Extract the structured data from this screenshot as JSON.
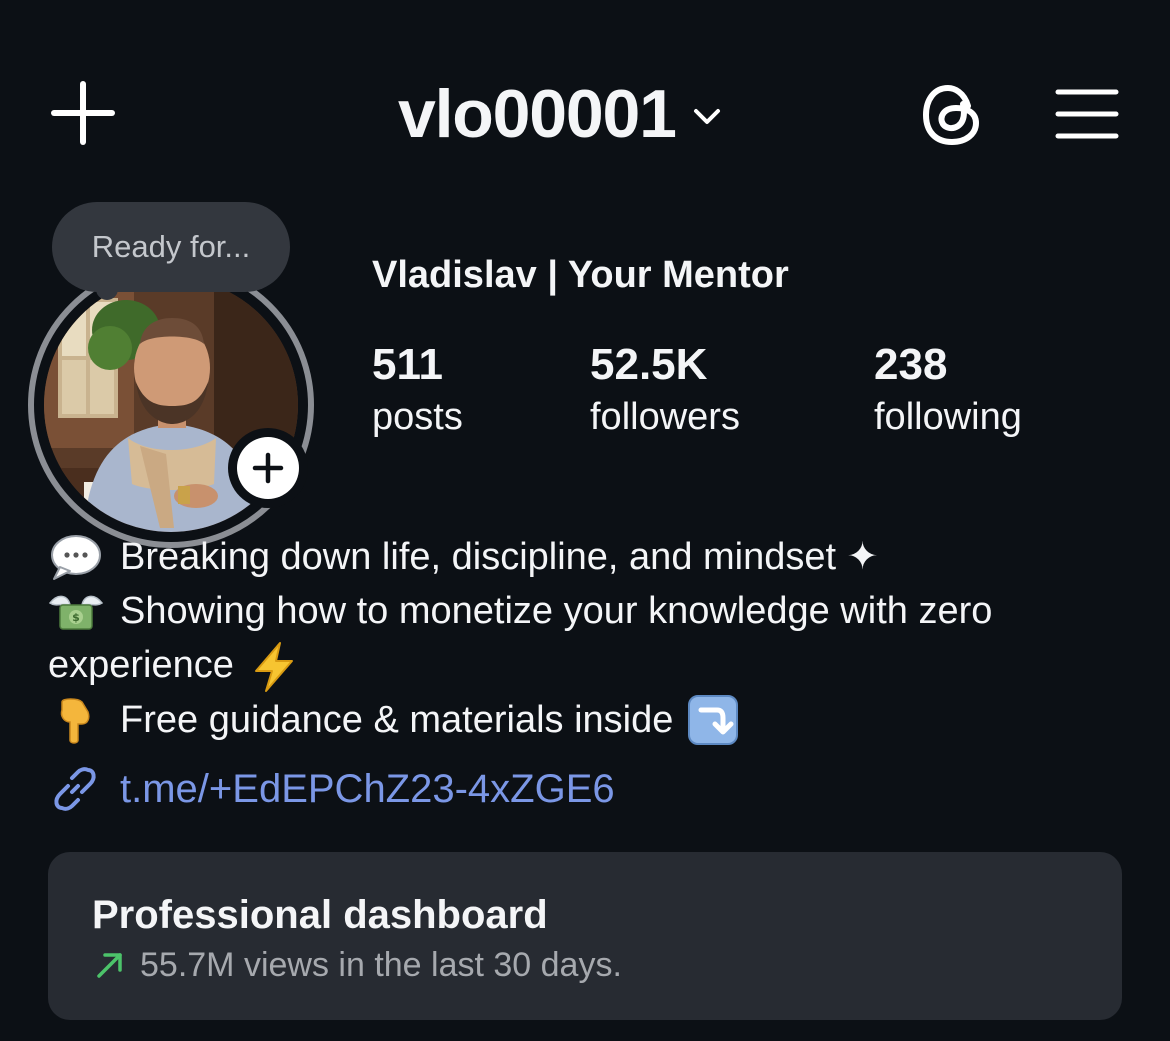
{
  "header": {
    "username": "vlo00001",
    "create_icon": "plus-icon",
    "username_dropdown_icon": "chevron-down-icon",
    "threads_icon": "threads-icon",
    "menu_icon": "hamburger-menu-icon"
  },
  "profile": {
    "note": "Ready for...",
    "display_name": "Vladislav | Your Mentor",
    "add_story_icon": "plus-icon",
    "stats": [
      {
        "value": "511",
        "label": "posts"
      },
      {
        "value": "52.5K",
        "label": "followers"
      },
      {
        "value": "238",
        "label": "following"
      }
    ]
  },
  "bio": {
    "line1": "Breaking down life, discipline, and mindset ✦",
    "line1_icon": "speech-bubble-emoji",
    "line2": "Showing how to monetize your knowledge with zero experience",
    "line2_icon": "money-with-wings-emoji",
    "line2_trailing_icon": "lightning-emoji",
    "line3": "Free guidance & materials inside",
    "line3_icon": "pointing-down-emoji",
    "line3_trailing_icon": "arrow-down-right-emoji",
    "link": "t.me/+EdEPChZ23-4xZGE6",
    "link_icon": "link-icon"
  },
  "dashboard": {
    "title": "Professional dashboard",
    "subtitle": "55.7M views in the last 30 days.",
    "trend_icon": "trend-up-arrow-icon"
  },
  "colors": {
    "background": "#0c1015",
    "text": "#f4f5f7",
    "link": "#7b97e6",
    "card": "#272b32",
    "trend": "#4cc36a"
  }
}
